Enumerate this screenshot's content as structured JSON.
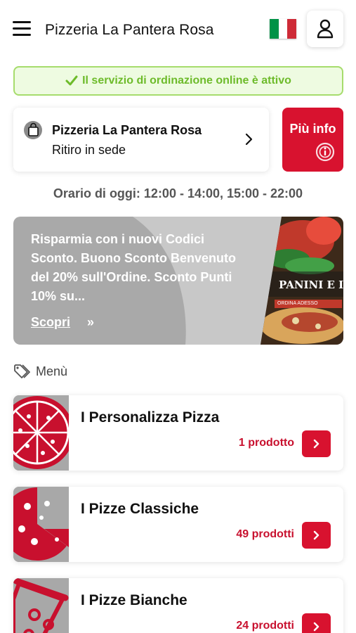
{
  "header": {
    "title": "Pizzeria La Pantera Rosa",
    "menu_icon": "hamburger-icon",
    "language_flag": "italy-flag-icon",
    "account_icon": "user-icon"
  },
  "status": {
    "text": "Il servizio di ordinazione online è attivo",
    "icon": "check-icon",
    "color": "#6dbb2a",
    "border_color": "#a6dc6c"
  },
  "store": {
    "name": "Pizzeria La Pantera Rosa",
    "mode": "Ritiro in sede",
    "icon": "shopping-bag-icon"
  },
  "info_button": {
    "label": "Più info",
    "icon": "info-icon"
  },
  "hours": {
    "text": "Orario di oggi: 12:00 - 14:00, 15:00 - 22:00"
  },
  "promo": {
    "text": "Risparmia con i nuovi Codici Sconto. Buono Sconto Benvenuto del 20% sull'Ordine. Sconto Punti 10% su...",
    "link_label": "Scopri",
    "link_arrows": "»",
    "image_caption": "PANINI E INS",
    "image_subcaption": "ORDINA ADESSO"
  },
  "menu": {
    "heading": "Menù",
    "heading_icon": "tag-icon",
    "categories": [
      {
        "name": "I Personalizza Pizza",
        "count": "1 prodotto",
        "icon": "pizza-icon"
      },
      {
        "name": "I Pizze Classiche",
        "count": "49 prodotti",
        "icon": "pizza-icon"
      },
      {
        "name": "I Pizze Bianche",
        "count": "24 prodotti",
        "icon": "pizza-slice-icon"
      }
    ]
  },
  "colors": {
    "accent": "#d8122f",
    "flag_green": "#009246",
    "flag_white": "#ffffff",
    "flag_red": "#ce2b37"
  }
}
